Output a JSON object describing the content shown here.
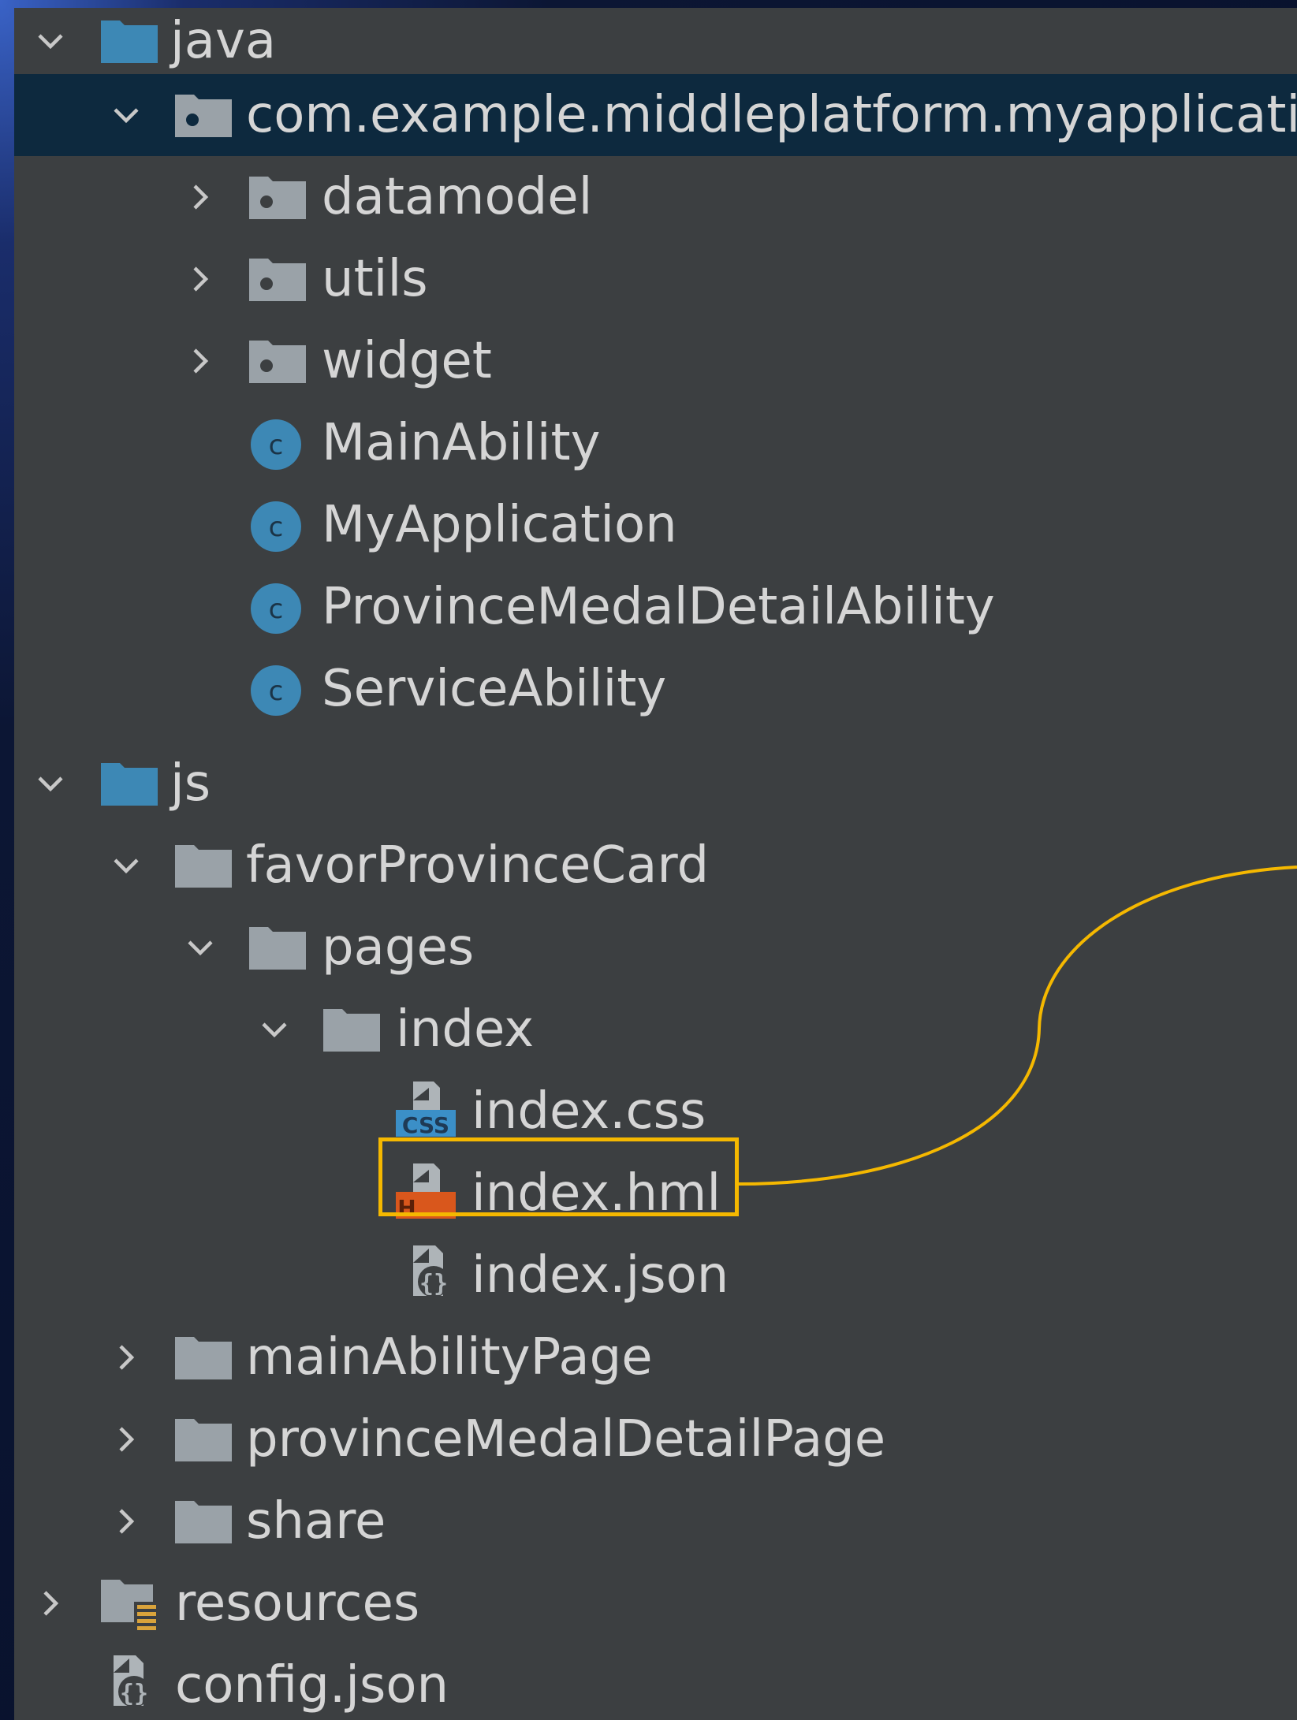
{
  "tree": {
    "items": [
      {
        "label": "java",
        "type": "folder-blue",
        "expanded": true
      },
      {
        "label": "com.example.middleplatform.myapplication",
        "type": "package",
        "expanded": true,
        "selected": true
      },
      {
        "label": "datamodel",
        "type": "package",
        "expanded": false
      },
      {
        "label": "utils",
        "type": "package",
        "expanded": false
      },
      {
        "label": "widget",
        "type": "package",
        "expanded": false
      },
      {
        "label": "MainAbility",
        "type": "class"
      },
      {
        "label": "MyApplication",
        "type": "class"
      },
      {
        "label": "ProvinceMedalDetailAbility",
        "type": "class"
      },
      {
        "label": "ServiceAbility",
        "type": "class"
      },
      {
        "label": "js",
        "type": "folder-blue",
        "expanded": true
      },
      {
        "label": "favorProvinceCard",
        "type": "folder",
        "expanded": true
      },
      {
        "label": "pages",
        "type": "folder",
        "expanded": true
      },
      {
        "label": "index",
        "type": "folder",
        "expanded": true
      },
      {
        "label": "index.css",
        "type": "css-file"
      },
      {
        "label": "index.hml",
        "type": "hml-file",
        "highlighted": true
      },
      {
        "label": "index.json",
        "type": "json-file"
      },
      {
        "label": "mainAbilityPage",
        "type": "folder",
        "expanded": false
      },
      {
        "label": "provinceMedalDetailPage",
        "type": "folder",
        "expanded": false
      },
      {
        "label": "share",
        "type": "folder",
        "expanded": false
      },
      {
        "label": "resources",
        "type": "resources-folder",
        "expanded": false
      },
      {
        "label": "config.json",
        "type": "json-file"
      }
    ],
    "icon_badges": {
      "class": "c",
      "css": "CSS",
      "hml": "H",
      "json": "{}"
    }
  },
  "colors": {
    "panel_bg": "#3c3f41",
    "selected_row": "#0d293e",
    "text": "#d5d5d5",
    "folder_blue": "#3d88b5",
    "folder_gray": "#9aa2a8",
    "class_icon": "#3d88b5",
    "css_badge": "#3b8fc7",
    "hml_badge": "#d9571c",
    "highlight": "#f5b800"
  }
}
